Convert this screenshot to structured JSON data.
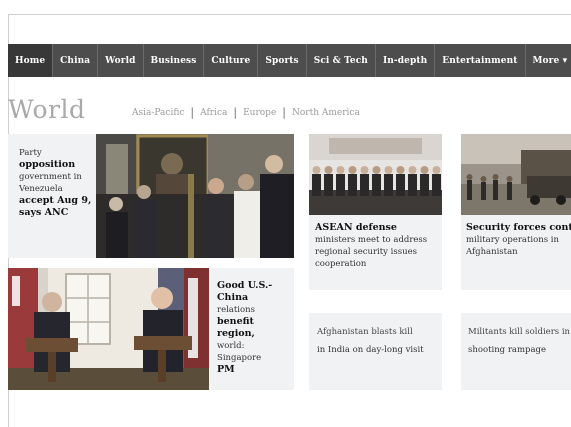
{
  "nav": {
    "items": [
      {
        "label": "Home",
        "active": true
      },
      {
        "label": "China",
        "active": false
      },
      {
        "label": "World",
        "active": false
      },
      {
        "label": "Business",
        "active": false
      },
      {
        "label": "Culture",
        "active": false
      },
      {
        "label": "Sports",
        "active": false
      },
      {
        "label": "Sci & Tech",
        "active": false
      },
      {
        "label": "In-depth",
        "active": false
      },
      {
        "label": "Entertainment",
        "active": false
      },
      {
        "label": "More ▾",
        "active": false
      }
    ]
  },
  "section": {
    "title": "World",
    "subnav": [
      "Asia-Pacific",
      "Africa",
      "Europe",
      "North America"
    ]
  },
  "stories": {
    "lead": {
      "kicker": "Party",
      "headline_bold": "opposition",
      "lines": [
        "government in",
        "Venezuela",
        "accept Aug 9,",
        "says ANC"
      ]
    },
    "asean": {
      "headline": "ASEAN defense",
      "lines": [
        "ministers meet to address",
        "regional security issues",
        "cooperation"
      ]
    },
    "security": {
      "headline": "Security forces continue",
      "lines": [
        "military operations in",
        "Afghanistan"
      ]
    },
    "us_china": {
      "headline_lines": [
        "Good U.S.-",
        "China"
      ],
      "lines": [
        "relations",
        "benefit",
        "region,",
        "world:",
        "Singapore",
        "PM"
      ]
    },
    "brief_left": {
      "lines": [
        "Afghanistan blasts kill",
        "in India on day-long visit"
      ]
    },
    "brief_right": {
      "lines": [
        "Militants kill soldiers in",
        "shooting rampage"
      ]
    }
  }
}
